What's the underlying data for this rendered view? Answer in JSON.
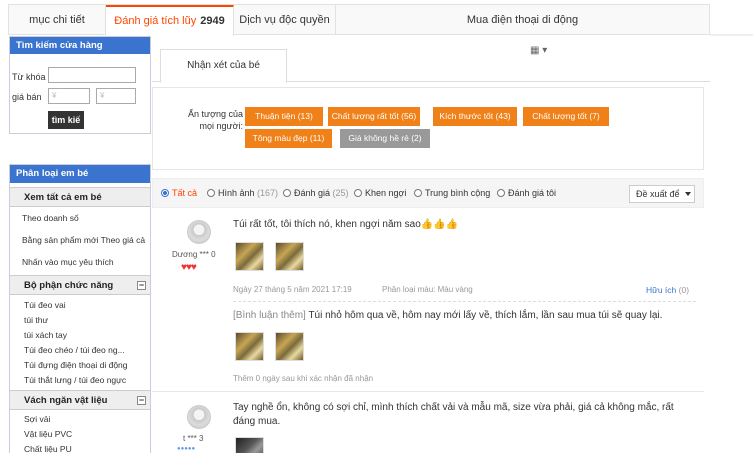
{
  "top_tabs": [
    {
      "label": "mục chi tiết"
    },
    {
      "label": "Đánh giá tích lũy",
      "count": "2949"
    },
    {
      "label": "Dịch vụ độc quyền"
    },
    {
      "label": "Mua điện thoại di động"
    }
  ],
  "search_box": {
    "title": "Tìm kiếm cửa hàng",
    "keyword_label": "Từ khóa",
    "price_label": "giá bán",
    "price_from_placeholder": "¥",
    "price_to_placeholder": "¥",
    "button_label": "tìm kiế"
  },
  "category": {
    "title": "Phân loại em bé",
    "sections": [
      {
        "title": "Xem tất cả em bé",
        "items": [
          "Theo doanh số",
          "Bằng sản phẩm mới Theo giá cả",
          "Nhấn vào mục yêu thích"
        ]
      },
      {
        "title": "Bộ phận chức năng",
        "items": [
          "Túi đeo vai",
          "túi thư",
          "túi xách tay",
          "Túi đeo chéo / túi đeo ng...",
          "Túi đựng điện thoại di động",
          "Túi thắt lưng / túi đeo ngực"
        ]
      },
      {
        "title": "Vách ngăn vật liệu",
        "items": [
          "Sợi vải",
          "Vật liệu PVC",
          "Chất liệu PU"
        ]
      }
    ],
    "toggle_symbol": "−"
  },
  "sub_tab": {
    "label": "Nhận xét của bé",
    "qr_glyph": "▦ ▾"
  },
  "impressions": {
    "label": "Ấn tượng của mọi người:",
    "tags": [
      "Thuận tiện (13)",
      "Chất lượng rất tốt (56)",
      "Kích thước tốt (43)",
      "Chất lượng tốt (7)",
      "Tông màu đẹp (11)",
      "Giá không hề rẻ (2)"
    ]
  },
  "filter": {
    "options": [
      {
        "label": "Tất cả",
        "count": ""
      },
      {
        "label": "Hình ảnh",
        "count": "(167)"
      },
      {
        "label": "Đánh giá",
        "count": "(25)"
      },
      {
        "label": "Khen ngợi",
        "count": ""
      },
      {
        "label": "Trung bình cộng",
        "count": ""
      },
      {
        "label": "Đánh giá tôi",
        "count": ""
      }
    ],
    "sort_label": "Đề xuất để"
  },
  "reviews": [
    {
      "user": "Dương *** 0",
      "level_glyphs": "♥♥♥",
      "text": "Túi rất tốt, tôi thích nó, khen ngợi năm sao👍👍👍",
      "date": "Ngày 27 tháng 5 năm 2021 17:19",
      "variant": "Phân loại màu: Màu vàng",
      "useful_label": "Hữu ích",
      "useful_count": "(0)",
      "append_tag": "[Bình luận thêm]",
      "append_text": "Túi nhỏ hôm qua về, hôm nay mới lấy về, thích lắm, lần sau mua túi sẽ quay lại.",
      "append_meta": "Thêm 0 ngày sau khi xác nhận đã nhận"
    },
    {
      "user": "t *** 3",
      "level_glyphs": "●●●●●",
      "text_line1": "Tay nghề ổn, không có sợi chỉ, mình thích chất vải và mẫu mã, size vừa phải, giá cả không mắc, rất",
      "text_line2": "đáng mua."
    }
  ]
}
